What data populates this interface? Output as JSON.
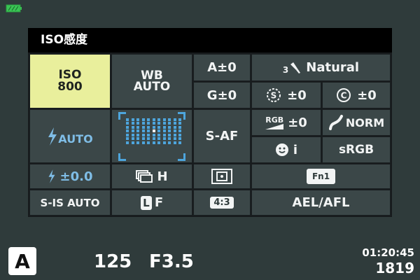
{
  "panel": {
    "title": "ISO感度"
  },
  "iso": {
    "label": "ISO",
    "value": "800"
  },
  "wb": {
    "line1": "WB",
    "line2": "AUTO"
  },
  "wb_a": "A±0",
  "wb_g": "G±0",
  "picture_mode": {
    "number": "3",
    "name": "Natural"
  },
  "sharpness": "±0",
  "contrast": "±0",
  "flash_mode": "AUTO",
  "af_mode": "S-AF",
  "saturation": {
    "icon_text": "RGB",
    "value": "±0"
  },
  "gradation": "NORM",
  "face_priority": "i",
  "color_space": "sRGB",
  "flash_comp": "±0.0",
  "drive": "H",
  "fn_button": "Fn1",
  "stabilizer": "S-IS AUTO",
  "image_quality": {
    "size": "L",
    "compression": "F"
  },
  "aspect": "4:3",
  "ael_afl": "AEL/AFL",
  "footer": {
    "mode": "A",
    "shutter": "125",
    "aperture": "F3.5",
    "time": "01:20:45",
    "shots": "1819"
  },
  "colors": {
    "background": "#2f3b3b",
    "panel": "#171b1d",
    "cell": "#3b4748",
    "selected": "#e9ef9c",
    "af_blue": "#4da5dc",
    "battery": "#39c454"
  },
  "icons": {
    "battery": "battery-icon",
    "picture_mode": "brush-icon",
    "sharpness": "sharpness-s-icon",
    "contrast": "contrast-c-icon",
    "flash": "flash-icon",
    "gradation": "gradation-curve-icon",
    "face": "face-icon",
    "drive": "sequential-drive-icon",
    "metering": "metering-icon",
    "quality": "quality-l-icon"
  }
}
